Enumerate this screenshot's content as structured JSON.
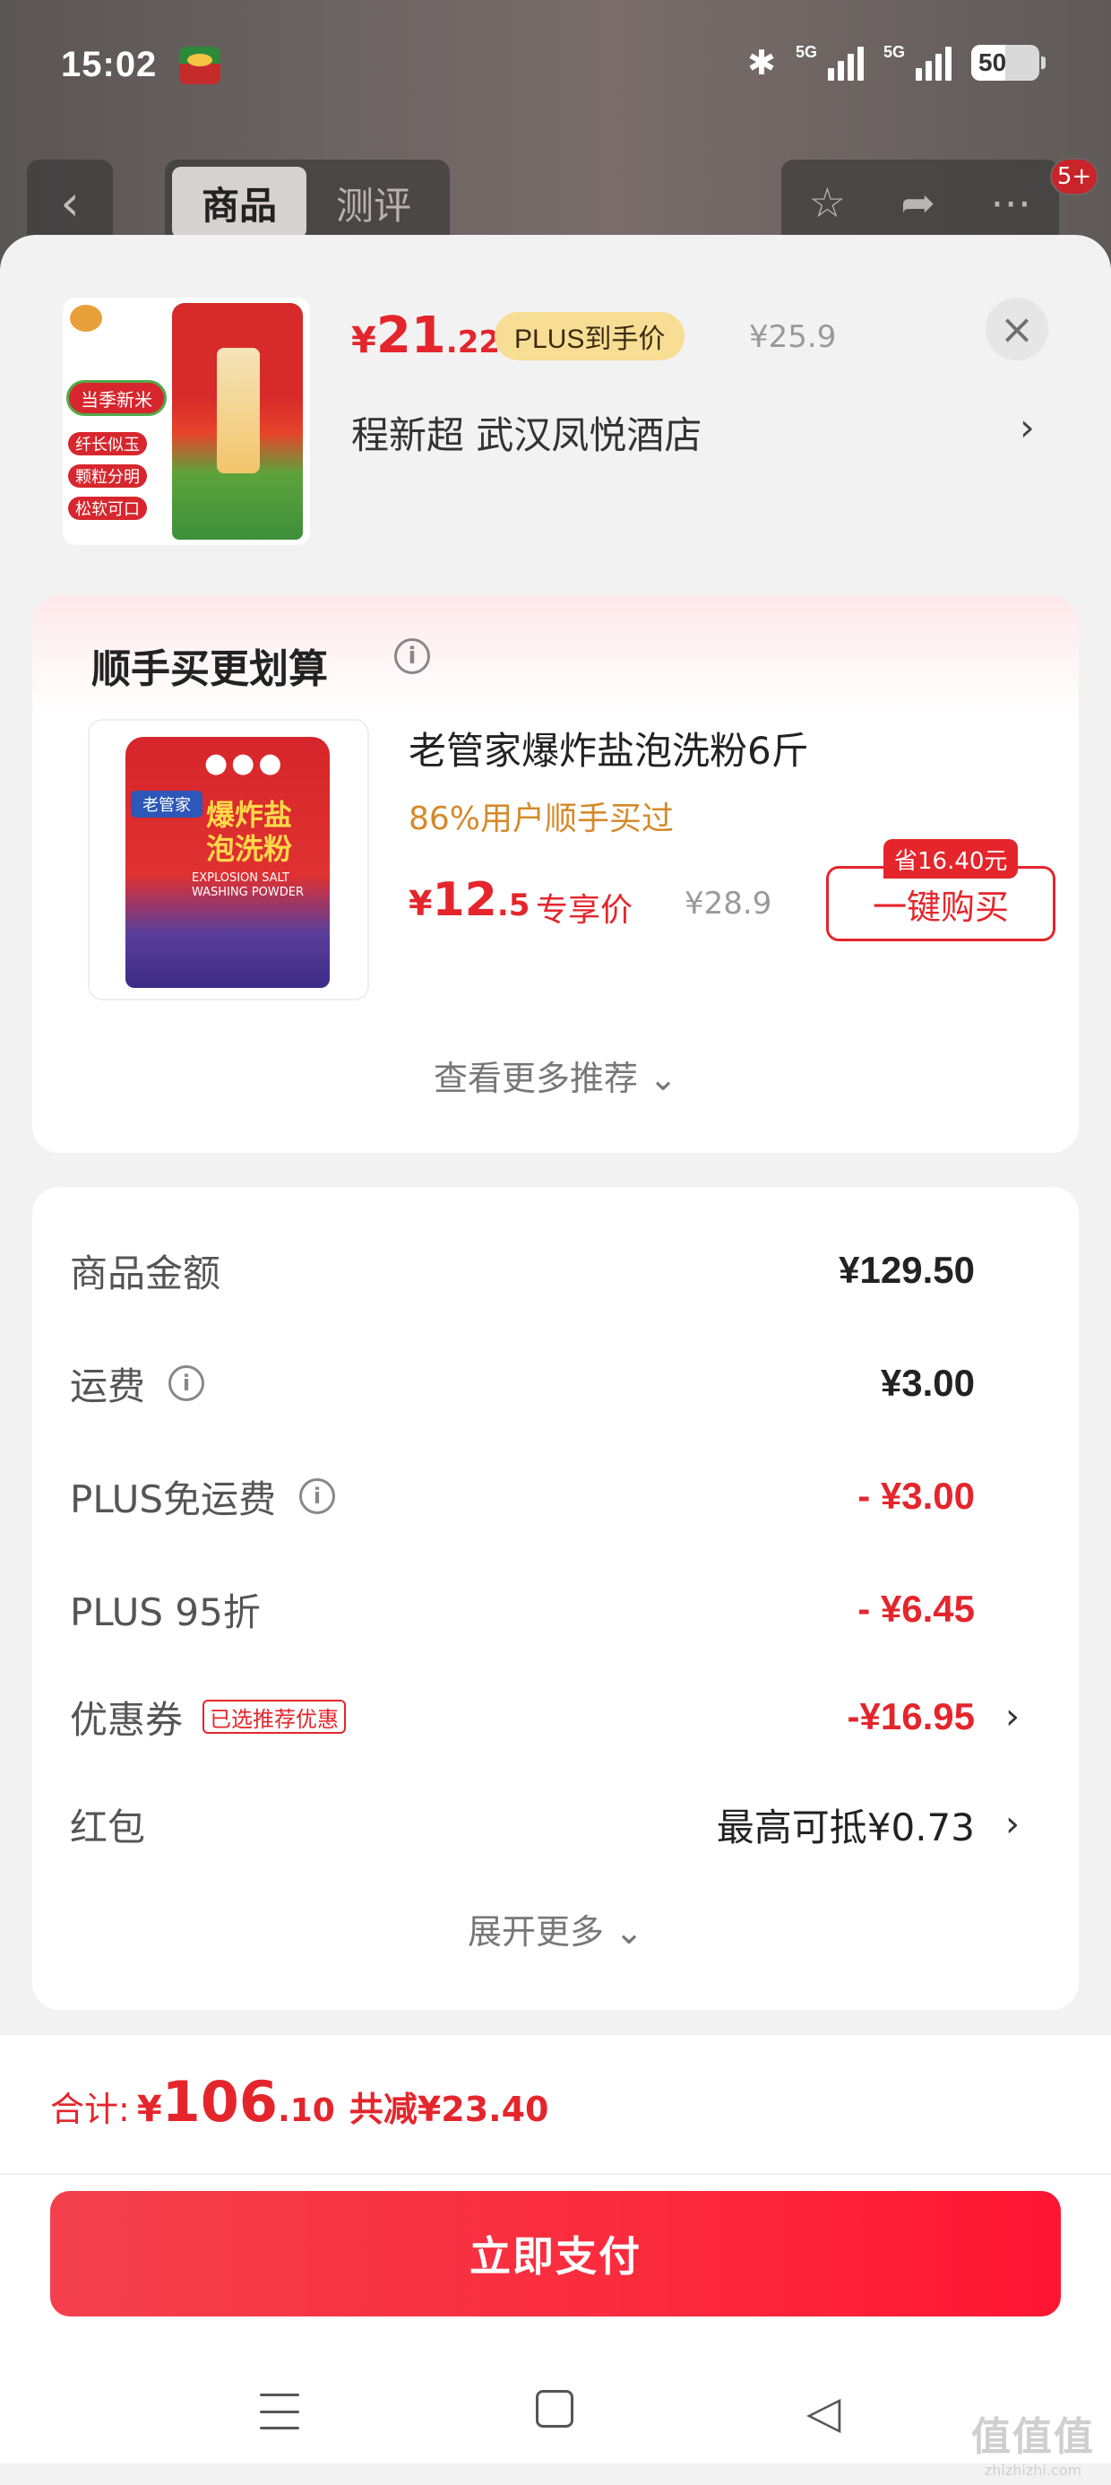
{
  "status": {
    "time": "15:02",
    "signal1_tag": "5G",
    "signal2_tag": "5G",
    "battery": "50",
    "battery_level": 0.5
  },
  "nav": {
    "back_icon": "chevron-left-icon",
    "tabs": [
      {
        "label": "商品",
        "active": true
      },
      {
        "label": "测评",
        "active": false
      }
    ],
    "actions": [
      "star-icon",
      "share-icon",
      "more-icon"
    ],
    "badge": "5+"
  },
  "product": {
    "rice_tags": [
      "当季新米",
      "纤长似玉",
      "颗粒分明",
      "松软可口"
    ],
    "price_symbol": "¥",
    "price_int": "21",
    "price_dec": ".22",
    "plus_label": "PLUS到手价",
    "original_price": "¥25.9",
    "address": "程新超  武汉凤悦酒店",
    "address_chevron": "›"
  },
  "recommend": {
    "title": "顺手买更划算",
    "item": {
      "pack_brand": "老管家",
      "pack_name": "爆炸盐\n泡洗粉",
      "pack_en": "EXPLOSION SALT\nWASHING POWDER",
      "name": "老管家爆炸盐泡洗粉6斤",
      "subtitle": "86%用户顺手买过",
      "price_symbol": "¥",
      "price_int": "12",
      "price_dec": ".5",
      "price_label": "专享价",
      "original_price": "¥28.9",
      "save_tag": "省16.40元",
      "buy_label": "一键购买"
    },
    "more_label": "查看更多推荐 ⌄"
  },
  "summary": {
    "rows": [
      {
        "label": "商品金额",
        "value": "¥129.50"
      },
      {
        "label": "运费",
        "value": "¥3.00"
      },
      {
        "label": "PLUS免运费",
        "value": "- ¥3.00"
      },
      {
        "label": "PLUS 95折",
        "value": "- ¥6.45"
      },
      {
        "label": "优惠券",
        "tag": "已选推荐优惠",
        "value": "-¥16.95"
      },
      {
        "label": "红包",
        "value": "最高可抵¥0.73"
      }
    ],
    "more_label": "展开更多 ⌄"
  },
  "footer": {
    "total_label": "合计:",
    "total_symbol": "¥",
    "total_int": "106",
    "total_dec": ".10",
    "save_label": "共减¥23.40",
    "pay_label": "立即支付"
  },
  "watermark": {
    "big": "值值值",
    "small": "zhizhizhi.com"
  },
  "colors": {
    "accent_red": "#e4262c",
    "plus_gold": "#f8dd94",
    "subtitle_orange": "#d48a2a"
  }
}
